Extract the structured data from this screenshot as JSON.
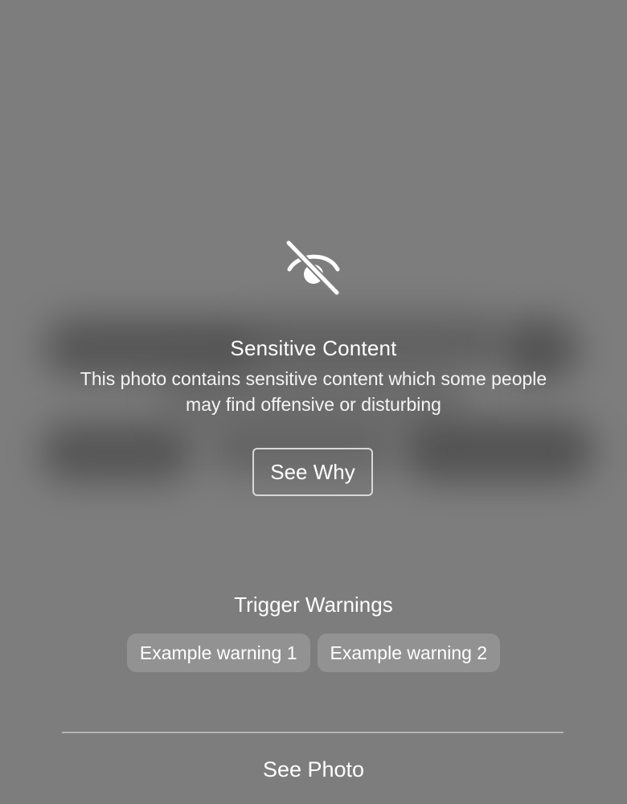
{
  "warning": {
    "icon": "eye-slash-icon",
    "title": "Sensitive Content",
    "description": "This photo contains sensitive content which some people may find offensive or disturbing",
    "see_why_label": "See Why"
  },
  "trigger_warnings": {
    "title": "Trigger Warnings",
    "items": [
      {
        "label": "Example warning 1"
      },
      {
        "label": "Example warning 2"
      }
    ]
  },
  "footer": {
    "see_photo_label": "See Photo"
  },
  "colors": {
    "background": "#7d7d7d",
    "text": "#ffffff",
    "chip_background": "#929292",
    "button_border": "#d8d8d8",
    "divider": "#b4b4b4"
  }
}
